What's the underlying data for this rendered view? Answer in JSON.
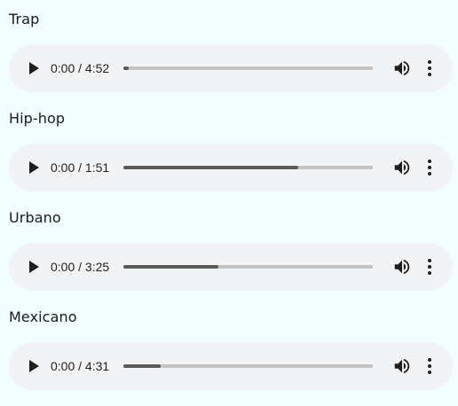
{
  "tracks": [
    {
      "title": "Trap",
      "time": "0:00 / 4:52",
      "buffered": 0.02
    },
    {
      "title": "Hip-hop",
      "time": "0:00 / 1:51",
      "buffered": 0.7
    },
    {
      "title": "Urbano",
      "time": "0:00 / 3:25",
      "buffered": 0.38
    },
    {
      "title": "Mexicano",
      "time": "0:00 / 4:31",
      "buffered": 0.15
    }
  ],
  "icons": {
    "play": "play-icon",
    "volume": "volume-icon",
    "more": "more-vert-icon"
  },
  "colors": {
    "background": "#f2fdff",
    "player": "#f1f3f4",
    "track": "#c3c3c3",
    "fill": "#5a5a5a"
  }
}
